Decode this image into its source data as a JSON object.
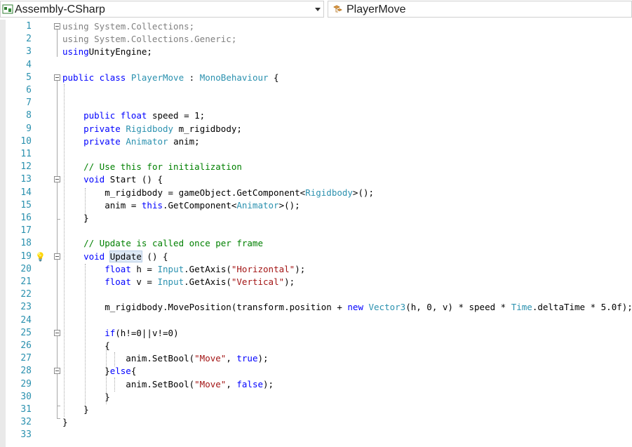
{
  "navbar": {
    "project": "Assembly-CSharp",
    "class_name": "PlayerMove"
  },
  "lines": [
    {
      "n": "1",
      "segs": [
        [
          "gr",
          "using System.Collections;"
        ]
      ]
    },
    {
      "n": "2",
      "segs": [
        [
          "gr",
          "using System.Collections.Generic;"
        ]
      ]
    },
    {
      "n": "3",
      "segs": [
        [
          "kw",
          "using"
        ],
        [
          "",
          "UnityEngine;"
        ]
      ]
    },
    {
      "n": "4",
      "segs": []
    },
    {
      "n": "5",
      "segs": [
        [
          "kw",
          "public class "
        ],
        [
          "ty",
          "PlayerMove"
        ],
        [
          "",
          " : "
        ],
        [
          "ty",
          "MonoBehaviour"
        ],
        [
          "",
          " {"
        ]
      ]
    },
    {
      "n": "6",
      "segs": []
    },
    {
      "n": "7",
      "segs": []
    },
    {
      "n": "8",
      "segs": [
        [
          "",
          "    "
        ],
        [
          "kw",
          "public float"
        ],
        [
          "",
          " speed = 1;"
        ]
      ]
    },
    {
      "n": "9",
      "segs": [
        [
          "",
          "    "
        ],
        [
          "kw",
          "private "
        ],
        [
          "ty",
          "Rigidbody"
        ],
        [
          "",
          " m_rigidbody;"
        ]
      ]
    },
    {
      "n": "10",
      "segs": [
        [
          "",
          "    "
        ],
        [
          "kw",
          "private "
        ],
        [
          "ty",
          "Animator"
        ],
        [
          "",
          " anim;"
        ]
      ]
    },
    {
      "n": "11",
      "segs": []
    },
    {
      "n": "12",
      "segs": [
        [
          "",
          "    "
        ],
        [
          "cm",
          "// Use this for initialization"
        ]
      ]
    },
    {
      "n": "13",
      "segs": [
        [
          "",
          "    "
        ],
        [
          "kw",
          "void"
        ],
        [
          "",
          " Start () {"
        ]
      ]
    },
    {
      "n": "14",
      "segs": [
        [
          "",
          "        m_rigidbody = gameObject.GetComponent<"
        ],
        [
          "ty",
          "Rigidbody"
        ],
        [
          "",
          ">();"
        ]
      ]
    },
    {
      "n": "15",
      "segs": [
        [
          "",
          "        anim = "
        ],
        [
          "kw",
          "this"
        ],
        [
          "",
          ".GetComponent<"
        ],
        [
          "ty",
          "Animator"
        ],
        [
          "",
          ">();"
        ]
      ]
    },
    {
      "n": "16",
      "segs": [
        [
          "",
          "    }"
        ]
      ]
    },
    {
      "n": "17",
      "segs": []
    },
    {
      "n": "18",
      "segs": [
        [
          "",
          "    "
        ],
        [
          "cm",
          "// Update is called once per frame"
        ]
      ]
    },
    {
      "n": "19",
      "segs": [
        [
          "",
          "    "
        ],
        [
          "kw",
          "void"
        ],
        [
          "",
          " "
        ],
        [
          "hl",
          "Update"
        ],
        [
          "",
          " () {"
        ]
      ]
    },
    {
      "n": "20",
      "segs": [
        [
          "",
          "        "
        ],
        [
          "kw",
          "float"
        ],
        [
          "",
          " h = "
        ],
        [
          "ty",
          "Input"
        ],
        [
          "",
          ".GetAxis("
        ],
        [
          "st",
          "\"Horizontal\""
        ],
        [
          "",
          ");"
        ]
      ]
    },
    {
      "n": "21",
      "segs": [
        [
          "",
          "        "
        ],
        [
          "kw",
          "float"
        ],
        [
          "",
          " v = "
        ],
        [
          "ty",
          "Input"
        ],
        [
          "",
          ".GetAxis("
        ],
        [
          "st",
          "\"Vertical\""
        ],
        [
          "",
          ");"
        ]
      ]
    },
    {
      "n": "22",
      "segs": []
    },
    {
      "n": "23",
      "segs": [
        [
          "",
          "        m_rigidbody.MovePosition(transform.position + "
        ],
        [
          "kw",
          "new"
        ],
        [
          "",
          " "
        ],
        [
          "ty",
          "Vector3"
        ],
        [
          "",
          "(h, 0, v) * speed * "
        ],
        [
          "ty",
          "Time"
        ],
        [
          "",
          ".deltaTime * 5.0f);"
        ]
      ]
    },
    {
      "n": "24",
      "segs": []
    },
    {
      "n": "25",
      "segs": [
        [
          "",
          "        "
        ],
        [
          "kw",
          "if"
        ],
        [
          "",
          "(h!=0||v!=0)"
        ]
      ]
    },
    {
      "n": "26",
      "segs": [
        [
          "",
          "        {"
        ]
      ]
    },
    {
      "n": "27",
      "segs": [
        [
          "",
          "            anim.SetBool("
        ],
        [
          "st",
          "\"Move\""
        ],
        [
          "",
          ", "
        ],
        [
          "kw",
          "true"
        ],
        [
          "",
          ");"
        ]
      ]
    },
    {
      "n": "28",
      "segs": [
        [
          "",
          "        }"
        ],
        [
          "kw",
          "else"
        ],
        [
          "",
          "{"
        ]
      ]
    },
    {
      "n": "29",
      "segs": [
        [
          "",
          "            anim.SetBool("
        ],
        [
          "st",
          "\"Move\""
        ],
        [
          "",
          ", "
        ],
        [
          "kw",
          "false"
        ],
        [
          "",
          ");"
        ]
      ]
    },
    {
      "n": "30",
      "segs": [
        [
          "",
          "        }"
        ]
      ]
    },
    {
      "n": "31",
      "segs": [
        [
          "",
          "    }"
        ]
      ]
    },
    {
      "n": "32",
      "segs": [
        [
          "",
          "}"
        ]
      ]
    },
    {
      "n": "33",
      "segs": []
    }
  ],
  "fold_lines": [
    "1",
    "5",
    "13",
    "19",
    "25",
    "28"
  ],
  "lightbulb_line": "19",
  "colors": {
    "keyword": "#0000ff",
    "type": "#2b91af",
    "string": "#a31515",
    "comment": "#008000",
    "gray": "#808080",
    "line_number": "#2b91af"
  },
  "icons": {
    "project_icon": "csharp-project-icon",
    "class_icon": "class-icon",
    "lightbulb": "lightbulb-icon"
  }
}
